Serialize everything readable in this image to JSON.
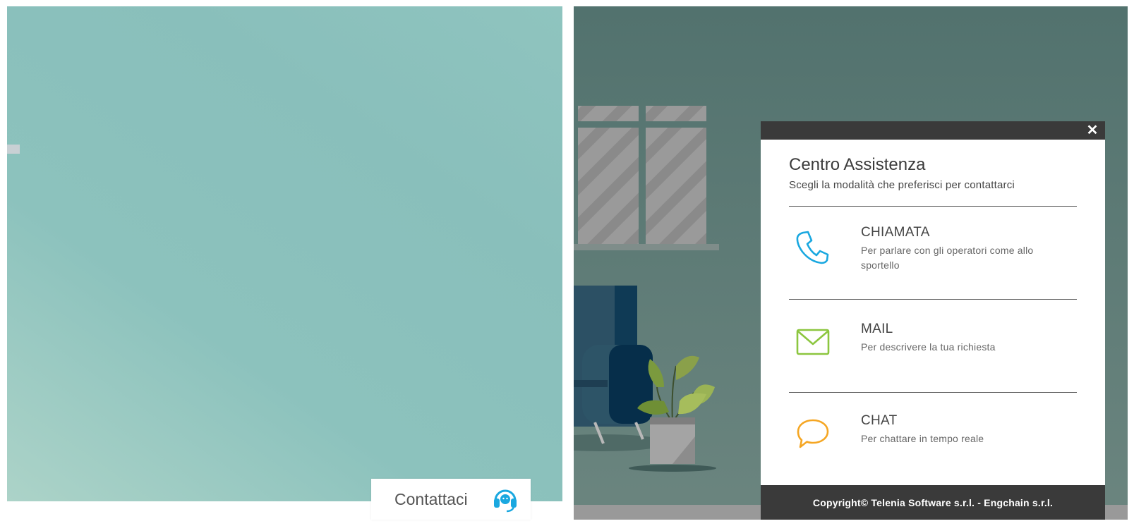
{
  "contact_tab": {
    "label": "Contattaci",
    "icon": "headset-icon",
    "icon_color": "#1aa8e0"
  },
  "modal": {
    "close_icon": "close-icon",
    "close_symbol": "✕",
    "title": "Centro Assistenza",
    "subtitle": "Scegli la modalità che preferisci per contattarci",
    "options": [
      {
        "id": "call",
        "title": "CHIAMATA",
        "description": "Per parlare con gli operatori come allo sportello",
        "icon": "phone-icon",
        "icon_color": "#1aa8e0"
      },
      {
        "id": "mail",
        "title": "MAIL",
        "description": "Per descrivere la tua richiesta",
        "icon": "envelope-icon",
        "icon_color": "#8cc63f"
      },
      {
        "id": "chat",
        "title": "CHAT",
        "description": "Per chattare in tempo reale",
        "icon": "chat-bubble-icon",
        "icon_color": "#f5a623"
      }
    ],
    "footer": "Copyright© Telenia Software s.r.l. - Engchain s.r.l."
  },
  "colors": {
    "left_panel": "#8cc2bd",
    "right_panel": "#537470",
    "modal_bar": "#3a3a3a"
  }
}
